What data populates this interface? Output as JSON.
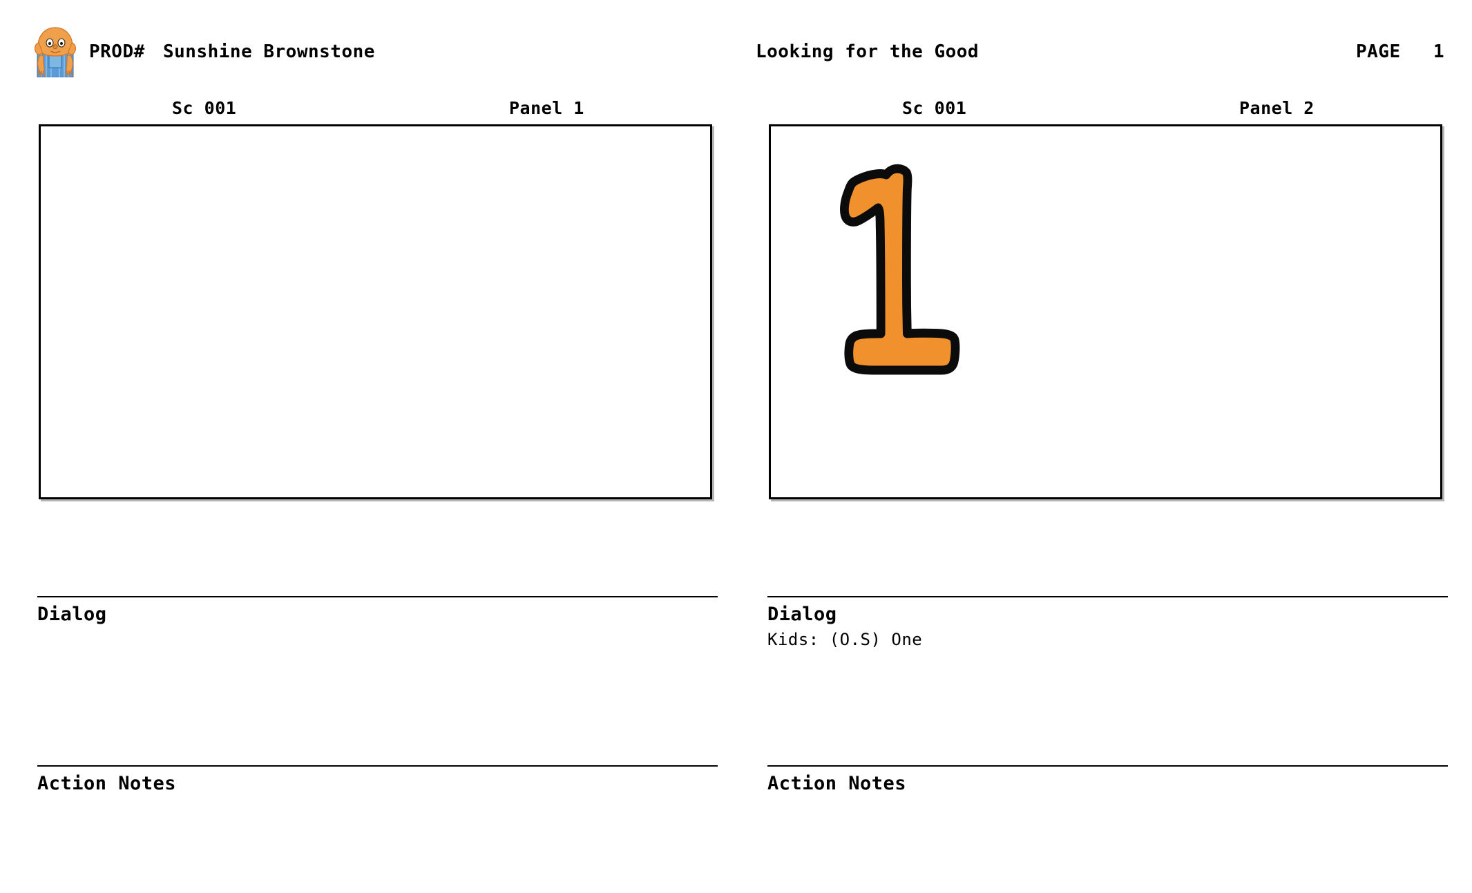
{
  "header": {
    "logo_icon": "character-mascot-icon",
    "prod_label": "PROD#",
    "prod_title": "Sunshine Brownstone",
    "episode_title": "Looking for the Good",
    "page_label": "PAGE",
    "page_number": "1"
  },
  "section_titles": {
    "dialog": "Dialog",
    "action_notes": "Action Notes"
  },
  "colors": {
    "panel_border": "#000000",
    "artwork_orange": "#F0912D",
    "artwork_outline": "#0B0B0B",
    "mascot_skin": "#F0A04B",
    "mascot_overalls": "#5B9BD5",
    "page_background": "#FFFFFF"
  },
  "panels": [
    {
      "scene": "Sc 001",
      "panel": "Panel 1",
      "artwork": "empty-frame",
      "dialog": "",
      "action_notes": ""
    },
    {
      "scene": "Sc 001",
      "panel": "Panel 2",
      "artwork": "hand-drawn-orange-numeral-one",
      "dialog": "Kids: (O.S) One",
      "action_notes": ""
    }
  ]
}
